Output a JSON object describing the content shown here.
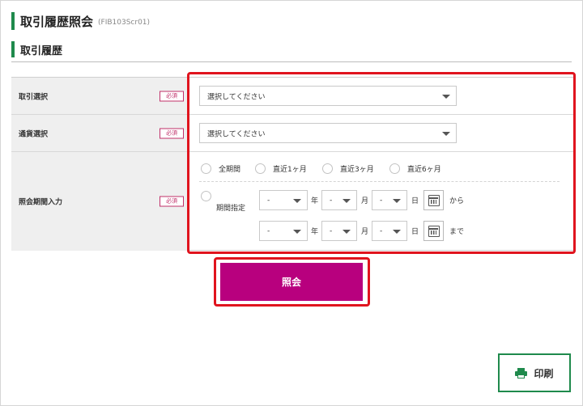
{
  "header": {
    "title": "取引履歴照会",
    "screen_code": "(FIB103Scr01)"
  },
  "section": {
    "title": "取引履歴"
  },
  "form": {
    "transaction_select": {
      "label": "取引選択",
      "required": "必須",
      "value": "選択してください"
    },
    "currency_select": {
      "label": "通貨選択",
      "required": "必須",
      "value": "選択してください"
    },
    "period": {
      "label": "照会期間入力",
      "required": "必須",
      "options": [
        "全期間",
        "直近1ヶ月",
        "直近3ヶ月",
        "直近6ヶ月"
      ],
      "custom_label": "期間指定",
      "from": {
        "year": "-",
        "month": "-",
        "day": "-"
      },
      "to": {
        "year": "-",
        "month": "-",
        "day": "-"
      },
      "units": {
        "year": "年",
        "month": "月",
        "day": "日"
      },
      "from_suffix": "から",
      "to_suffix": "まで"
    }
  },
  "actions": {
    "submit_label": "照会",
    "print_label": "印刷"
  },
  "colors": {
    "accent_green": "#1f8a4c",
    "submit_magenta": "#b8007e",
    "required_red": "#c0306a",
    "highlight_red": "#e0141e"
  }
}
